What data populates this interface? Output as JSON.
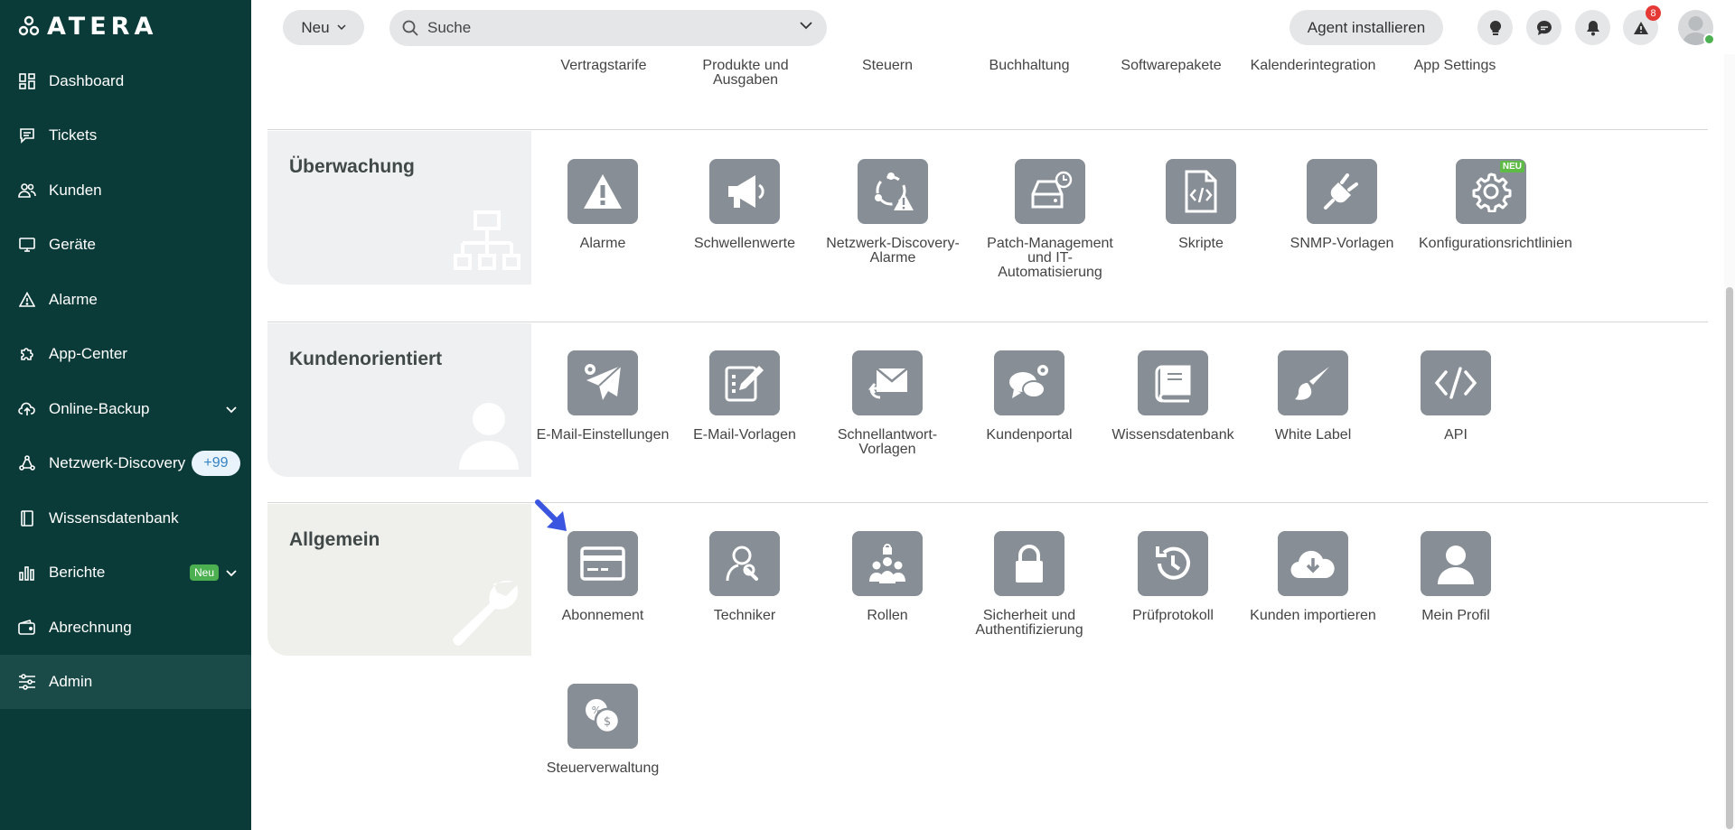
{
  "app": {
    "logo_text": "ATERA"
  },
  "sidebar": {
    "items": [
      {
        "label": "Dashboard"
      },
      {
        "label": "Tickets"
      },
      {
        "label": "Kunden"
      },
      {
        "label": "Geräte"
      },
      {
        "label": "Alarme"
      },
      {
        "label": "App-Center"
      },
      {
        "label": "Online-Backup"
      },
      {
        "label": "Netzwerk-Discovery",
        "badge": "+99"
      },
      {
        "label": "Wissensdatenbank"
      },
      {
        "label": "Berichte",
        "badge": "Neu"
      },
      {
        "label": "Abrechnung"
      },
      {
        "label": "Admin"
      }
    ]
  },
  "header": {
    "new_button": "Neu",
    "search_placeholder": "Suche",
    "agent_button": "Agent installieren",
    "alerts_count": "8"
  },
  "top_row": [
    "Vertragstarife",
    "Produkte und Ausgaben",
    "Steuern",
    "Buchhaltung",
    "Softwarepakete",
    "Kalenderintegration",
    "App Settings"
  ],
  "sections": {
    "monitoring": {
      "title": "Überwachung",
      "tiles": [
        "Alarme",
        "Schwellenwerte",
        "Netzwerk-Discovery-Alarme",
        "Patch-Management und IT-Automatisierung",
        "Skripte",
        "SNMP-Vorlagen",
        "Konfigurationsrichtlinien"
      ],
      "new_badge": "NEU"
    },
    "customer": {
      "title": "Kundenorientiert",
      "tiles": [
        "E-Mail-Einstellungen",
        "E-Mail-Vorlagen",
        "Schnellantwort-Vorlagen",
        "Kundenportal",
        "Wissensdatenbank",
        "White Label",
        "API"
      ]
    },
    "general": {
      "title": "Allgemein",
      "tiles": [
        "Abonnement",
        "Techniker",
        "Rollen",
        "Sicherheit und Authentifizierung",
        "Prüfprotokoll",
        "Kunden importieren",
        "Mein Profil",
        "Steuerverwaltung"
      ]
    }
  },
  "colors": {
    "sidebar_bg": "#0b3b38",
    "tile_bg": "#878e95",
    "accent_arrow": "#3a55e0"
  }
}
